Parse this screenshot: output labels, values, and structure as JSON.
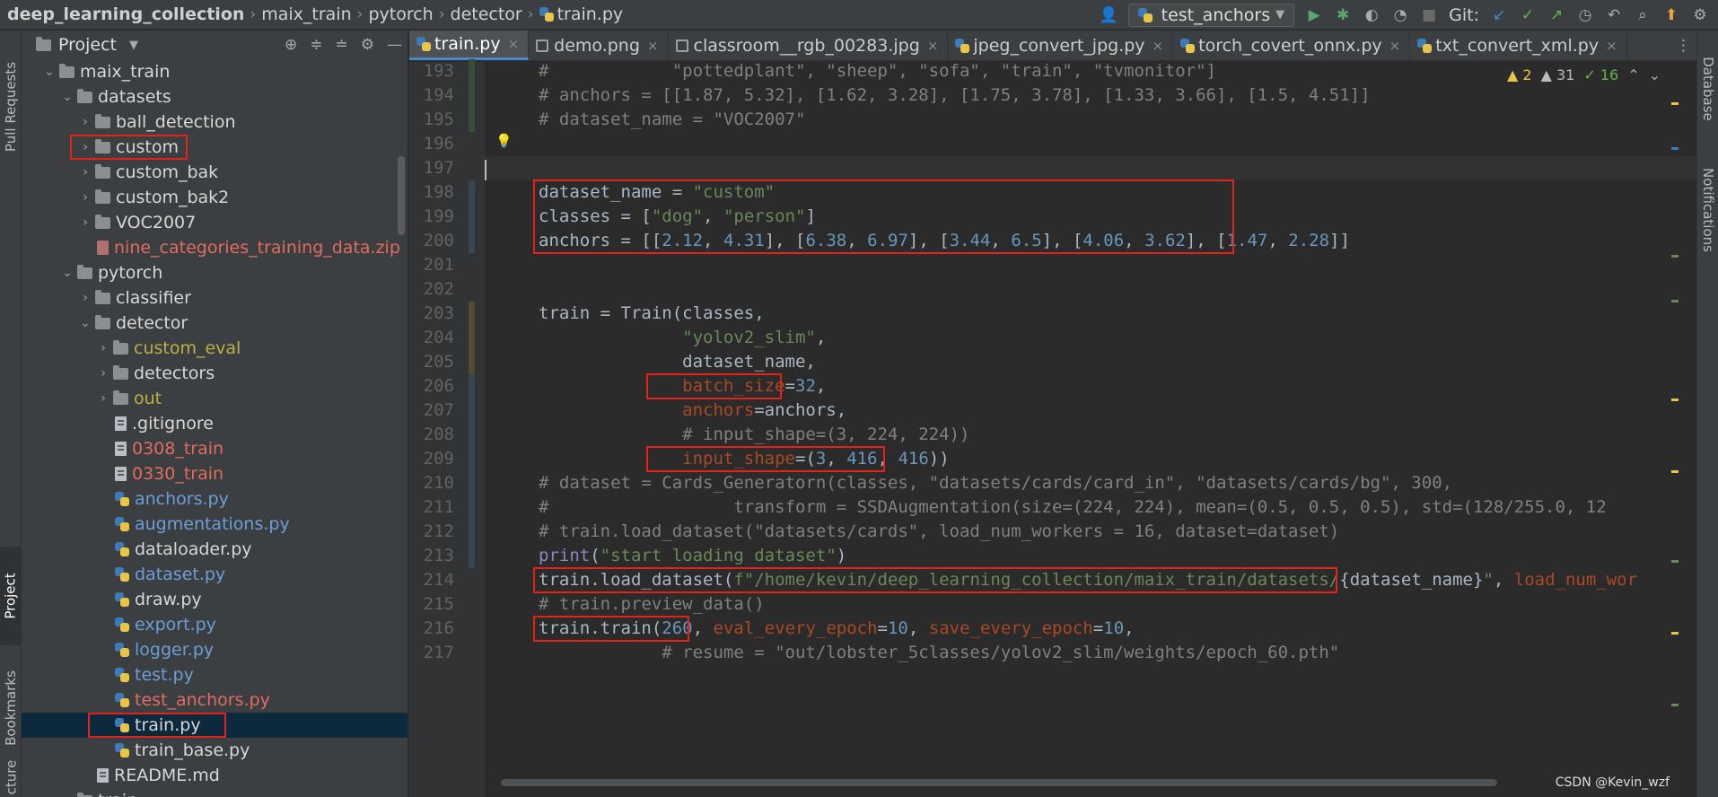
{
  "breadcrumb": {
    "project": "deep_learning_collection",
    "items": [
      "maix_train",
      "pytorch",
      "detector"
    ],
    "file": "train.py"
  },
  "toolbar": {
    "run_config": "test_anchors",
    "git_label": "Git:"
  },
  "side_tabs_left": [
    "Pull Requests",
    "Project",
    "Bookmarks",
    "cture"
  ],
  "side_tabs_right": [
    "Database",
    "Notifications"
  ],
  "project_panel": {
    "title": "Project",
    "rows": [
      {
        "name": "maix_train",
        "type": "folder",
        "indent": 0,
        "expanded": true,
        "color": "default"
      },
      {
        "name": "datasets",
        "type": "folder",
        "indent": 1,
        "expanded": true,
        "color": "default"
      },
      {
        "name": "ball_detection",
        "type": "folder",
        "indent": 2,
        "expanded": false,
        "color": "default"
      },
      {
        "name": "custom",
        "type": "folder",
        "indent": 2,
        "expanded": false,
        "color": "default",
        "boxed": true
      },
      {
        "name": "custom_bak",
        "type": "folder",
        "indent": 2,
        "expanded": false,
        "color": "default"
      },
      {
        "name": "custom_bak2",
        "type": "folder",
        "indent": 2,
        "expanded": false,
        "color": "default"
      },
      {
        "name": "VOC2007",
        "type": "folder",
        "indent": 2,
        "expanded": false,
        "color": "default"
      },
      {
        "name": "nine_categories_training_data.zip",
        "type": "zip",
        "indent": 2,
        "color": "red"
      },
      {
        "name": "pytorch",
        "type": "folder",
        "indent": 1,
        "expanded": true,
        "color": "default"
      },
      {
        "name": "classifier",
        "type": "folder",
        "indent": 2,
        "expanded": false,
        "color": "default"
      },
      {
        "name": "detector",
        "type": "folder",
        "indent": 2,
        "expanded": true,
        "color": "default"
      },
      {
        "name": "custom_eval",
        "type": "folder",
        "indent": 3,
        "expanded": false,
        "color": "olive"
      },
      {
        "name": "detectors",
        "type": "folder",
        "indent": 3,
        "expanded": false,
        "color": "default"
      },
      {
        "name": "out",
        "type": "folder",
        "indent": 3,
        "expanded": false,
        "color": "olive"
      },
      {
        "name": ".gitignore",
        "type": "file",
        "indent": 3,
        "color": "default"
      },
      {
        "name": "0308_train",
        "type": "file",
        "indent": 3,
        "color": "red"
      },
      {
        "name": "0330_train",
        "type": "file",
        "indent": 3,
        "color": "red"
      },
      {
        "name": "anchors.py",
        "type": "py",
        "indent": 3,
        "color": "blue"
      },
      {
        "name": "augmentations.py",
        "type": "py",
        "indent": 3,
        "color": "blue"
      },
      {
        "name": "dataloader.py",
        "type": "py",
        "indent": 3,
        "color": "default"
      },
      {
        "name": "dataset.py",
        "type": "py",
        "indent": 3,
        "color": "blue"
      },
      {
        "name": "draw.py",
        "type": "py",
        "indent": 3,
        "color": "default"
      },
      {
        "name": "export.py",
        "type": "py",
        "indent": 3,
        "color": "blue"
      },
      {
        "name": "logger.py",
        "type": "py",
        "indent": 3,
        "color": "blue"
      },
      {
        "name": "test.py",
        "type": "py",
        "indent": 3,
        "color": "blue"
      },
      {
        "name": "test_anchors.py",
        "type": "py",
        "indent": 3,
        "color": "red"
      },
      {
        "name": "train.py",
        "type": "py",
        "indent": 3,
        "color": "default",
        "selected": true,
        "boxed": true
      },
      {
        "name": "train_base.py",
        "type": "py",
        "indent": 3,
        "color": "default"
      },
      {
        "name": "README.md",
        "type": "file",
        "indent": 2,
        "color": "default"
      },
      {
        "name": "train",
        "type": "folder",
        "indent": 1,
        "expanded": false,
        "color": "default"
      }
    ]
  },
  "tabs": [
    {
      "label": "train.py",
      "icon": "py",
      "active": true
    },
    {
      "label": "demo.png",
      "icon": "img",
      "active": false
    },
    {
      "label": "classroom__rgb_00283.jpg",
      "icon": "img",
      "active": false
    },
    {
      "label": "jpeg_convert_jpg.py",
      "icon": "py",
      "active": false
    },
    {
      "label": "torch_covert_onnx.py",
      "icon": "py",
      "active": false
    },
    {
      "label": "txt_convert_xml.py",
      "icon": "py",
      "active": false
    }
  ],
  "inspections": {
    "warnings": "2",
    "weak": "31",
    "ok": "16"
  },
  "code_lines": [
    {
      "n": "193",
      "tokens": [
        [
          "com",
          "#            \"pottedplant\", \"sheep\", \"sofa\", \"train\", \"tvmonitor\"]"
        ]
      ]
    },
    {
      "n": "194",
      "tokens": [
        [
          "com",
          "# anchors = [[1.87, 5.32], [1.62, 3.28], [1.75, 3.78], [1.33, 3.66], [1.5, 4.51]]"
        ]
      ]
    },
    {
      "n": "195",
      "tokens": [
        [
          "com",
          "# dataset_name = \"VOC2007\""
        ]
      ]
    },
    {
      "n": "196",
      "tokens": []
    },
    {
      "n": "197",
      "tokens": []
    },
    {
      "n": "198",
      "tokens": [
        [
          "txt",
          "dataset_name = "
        ],
        [
          "str",
          "\"custom\""
        ]
      ]
    },
    {
      "n": "199",
      "tokens": [
        [
          "txt",
          "classes = ["
        ],
        [
          "str",
          "\"dog\""
        ],
        [
          "txt",
          ", "
        ],
        [
          "str",
          "\"person\""
        ],
        [
          "txt",
          "]"
        ]
      ]
    },
    {
      "n": "200",
      "tokens": [
        [
          "txt",
          "anchors = [["
        ],
        [
          "num",
          "2.12"
        ],
        [
          "txt",
          ", "
        ],
        [
          "num",
          "4.31"
        ],
        [
          "txt",
          "], ["
        ],
        [
          "num",
          "6.38"
        ],
        [
          "txt",
          ", "
        ],
        [
          "num",
          "6.97"
        ],
        [
          "txt",
          "], ["
        ],
        [
          "num",
          "3.44"
        ],
        [
          "txt",
          ", "
        ],
        [
          "num",
          "6.5"
        ],
        [
          "txt",
          "], ["
        ],
        [
          "num",
          "4.06"
        ],
        [
          "txt",
          ", "
        ],
        [
          "num",
          "3.62"
        ],
        [
          "txt",
          "], ["
        ],
        [
          "num",
          "1.47"
        ],
        [
          "txt",
          ", "
        ],
        [
          "num",
          "2.28"
        ],
        [
          "txt",
          "]]"
        ]
      ]
    },
    {
      "n": "201",
      "tokens": []
    },
    {
      "n": "202",
      "tokens": []
    },
    {
      "n": "203",
      "tokens": [
        [
          "txt",
          "train = Train(classes,"
        ]
      ]
    },
    {
      "n": "204",
      "tokens": [
        [
          "txt",
          "              "
        ],
        [
          "str",
          "\"yolov2_slim\""
        ],
        [
          "txt",
          ","
        ]
      ]
    },
    {
      "n": "205",
      "tokens": [
        [
          "txt",
          "              dataset_name,"
        ]
      ]
    },
    {
      "n": "206",
      "tokens": [
        [
          "txt",
          "              "
        ],
        [
          "par",
          "batch_size"
        ],
        [
          "txt",
          "="
        ],
        [
          "num",
          "32"
        ],
        [
          "txt",
          ","
        ]
      ]
    },
    {
      "n": "207",
      "tokens": [
        [
          "txt",
          "              "
        ],
        [
          "par",
          "anchors"
        ],
        [
          "txt",
          "=anchors,"
        ]
      ]
    },
    {
      "n": "208",
      "tokens": [
        [
          "txt",
          "              "
        ],
        [
          "com",
          "# input_shape=(3, 224, 224))"
        ]
      ]
    },
    {
      "n": "209",
      "tokens": [
        [
          "txt",
          "              "
        ],
        [
          "par",
          "input_shape"
        ],
        [
          "txt",
          "=("
        ],
        [
          "num",
          "3"
        ],
        [
          "txt",
          ", "
        ],
        [
          "num",
          "416"
        ],
        [
          "txt",
          ", "
        ],
        [
          "num",
          "416"
        ],
        [
          "txt",
          "))"
        ]
      ]
    },
    {
      "n": "210",
      "tokens": [
        [
          "com",
          "# dataset = Cards_Generatorn(classes, \"datasets/cards/card_in\", \"datasets/cards/bg\", 300,"
        ]
      ]
    },
    {
      "n": "211",
      "tokens": [
        [
          "com",
          "#                  transform = SSDAugmentation(size=(224, 224), mean=(0.5, 0.5, 0.5), std=(128/255.0, 12"
        ]
      ]
    },
    {
      "n": "212",
      "tokens": [
        [
          "com",
          "# train.load_dataset(\"datasets/cards\", load_num_workers = 16, dataset=dataset)"
        ]
      ]
    },
    {
      "n": "213",
      "tokens": [
        [
          "bi",
          "print"
        ],
        [
          "txt",
          "("
        ],
        [
          "str",
          "\"start loading dataset\""
        ],
        [
          "txt",
          ")"
        ]
      ]
    },
    {
      "n": "214",
      "tokens": [
        [
          "txt",
          "train.load_dataset("
        ],
        [
          "str",
          "f\"/home/kevin/deep_learning_collection/maix_train/datasets/"
        ],
        [
          "txt",
          "{dataset_name}"
        ],
        [
          "str",
          "\""
        ],
        [
          "txt",
          ", "
        ],
        [
          "par",
          "load_num_wor"
        ]
      ]
    },
    {
      "n": "215",
      "tokens": [
        [
          "com",
          "# train.preview_data()"
        ]
      ]
    },
    {
      "n": "216",
      "tokens": [
        [
          "txt",
          "train.train("
        ],
        [
          "num",
          "260"
        ],
        [
          "txt",
          ", "
        ],
        [
          "par",
          "eval_every_epoch"
        ],
        [
          "txt",
          "="
        ],
        [
          "num",
          "10"
        ],
        [
          "txt",
          ", "
        ],
        [
          "par",
          "save_every_epoch"
        ],
        [
          "txt",
          "="
        ],
        [
          "num",
          "10"
        ],
        [
          "txt",
          ","
        ]
      ]
    },
    {
      "n": "217",
      "tokens": [
        [
          "com",
          "            # resume = \"out/lobster_5classes/yolov2_slim/weights/epoch_60.pth\""
        ]
      ]
    }
  ],
  "watermark": "CSDN @Kevin_wzf",
  "colors": {
    "highlight_box": "#e2231a",
    "selection": "#0d293e",
    "background": "#2b2b2b",
    "panel": "#3c3f41"
  }
}
